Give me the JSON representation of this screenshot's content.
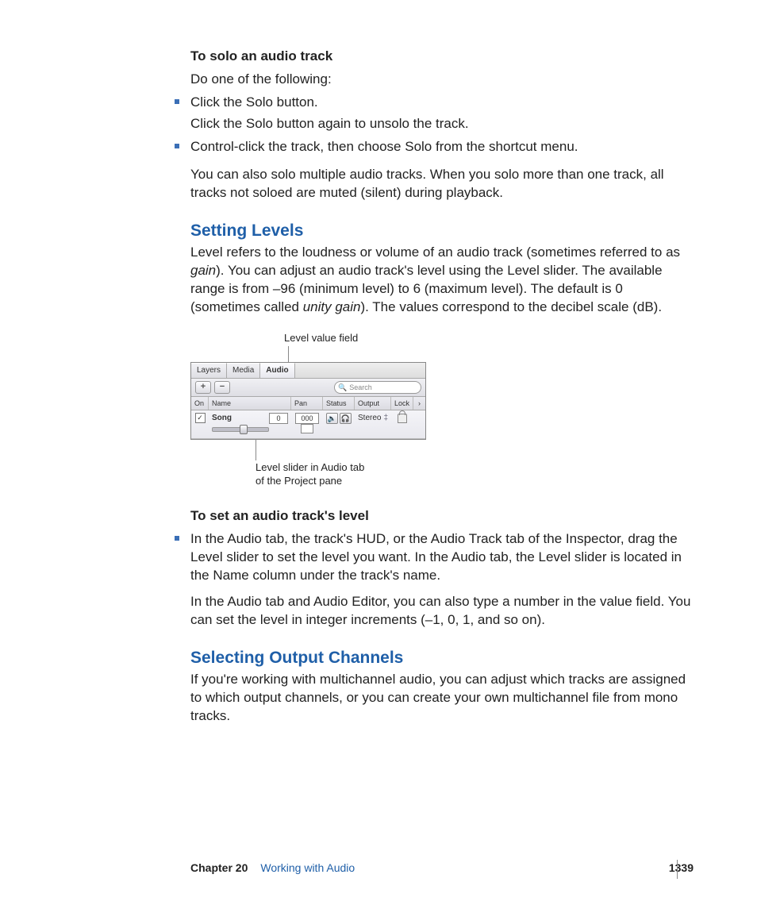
{
  "solo": {
    "heading": "To solo an audio track",
    "intro": "Do one of the following:",
    "bullets": [
      {
        "main": "Click the Solo button.",
        "follow": "Click the Solo button again to unsolo the track."
      },
      {
        "main": "Control-click the track, then choose Solo from the shortcut menu."
      }
    ],
    "after": "You can also solo multiple audio tracks. When you solo more than one track, all tracks not soloed are muted (silent) during playback."
  },
  "levels": {
    "heading": "Setting Levels",
    "para_pre": "Level refers to the loudness or volume of an audio track (sometimes referred to as ",
    "gain": "gain",
    "para_mid": "). You can adjust an audio track's level using the Level slider. The available range is from –96 (minimum level) to 6 (maximum level). The default is 0 (sometimes called ",
    "unity": "unity gain",
    "para_post": "). The values correspond to the decibel scale (dB)."
  },
  "diagram": {
    "callout_top": "Level value field",
    "tabs": [
      "Layers",
      "Media",
      "Audio"
    ],
    "plus": "+",
    "minus": "−",
    "search_placeholder": "Search",
    "cols": {
      "on": "On",
      "name": "Name",
      "pan": "Pan",
      "status": "Status",
      "output": "Output",
      "lock": "Lock",
      "more": "›"
    },
    "row": {
      "track_name": "Song",
      "level_value": "0",
      "pan_value": "000",
      "output_value": "Stereo",
      "output_arrows": "‡"
    },
    "status_icons": {
      "speaker": "🔈",
      "headphones": "🎧"
    },
    "callout_bottom_l1": "Level slider in Audio tab",
    "callout_bottom_l2": "of the Project pane"
  },
  "setlevel": {
    "heading": "To set an audio track's level",
    "bullet": "In the Audio tab, the track's HUD, or the Audio Track tab of the Inspector, drag the Level slider to set the level you want. In the Audio tab, the Level slider is located in the Name column under the track's name.",
    "after": "In the Audio tab and Audio Editor, you can also type a number in the value field. You can set the level in integer increments (–1, 0, 1, and so on)."
  },
  "output": {
    "heading": "Selecting Output Channels",
    "para": "If you're working with multichannel audio, you can adjust which tracks are assigned to which output channels, or you can create your own multichannel file from mono tracks."
  },
  "footer": {
    "chapter": "Chapter 20",
    "title": "Working with Audio",
    "page": "1339"
  },
  "glyphs": {
    "search": "🔍",
    "check": "✓"
  }
}
